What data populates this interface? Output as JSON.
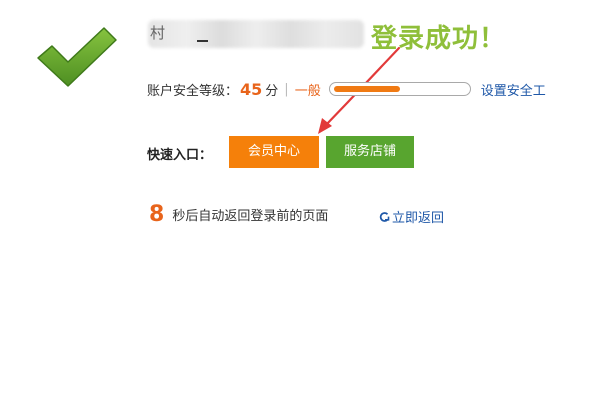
{
  "user": {
    "name_visible_char": "村"
  },
  "annotation": {
    "text": "登录成功！",
    "color": "#8fbf3a"
  },
  "security": {
    "label": "账户安全等级：",
    "score": "45",
    "score_unit": "分",
    "separator": "|",
    "level": "一般",
    "progress_fraction": 0.5,
    "link_text": "设置安全工"
  },
  "quick_entry": {
    "label": "快速入口：",
    "buttons": [
      {
        "label": "会员中心",
        "color": "#f5800a"
      },
      {
        "label": "服务店铺",
        "color": "#58a52f"
      }
    ]
  },
  "countdown": {
    "seconds": "8",
    "text": "秒后自动返回登录前的页面"
  },
  "back_link": {
    "label": "立即返回",
    "icon": "return-arrow-icon"
  },
  "colors": {
    "accent_orange": "#e8641b",
    "link_blue": "#1f58a8",
    "check_green": "#5f9f2a"
  }
}
